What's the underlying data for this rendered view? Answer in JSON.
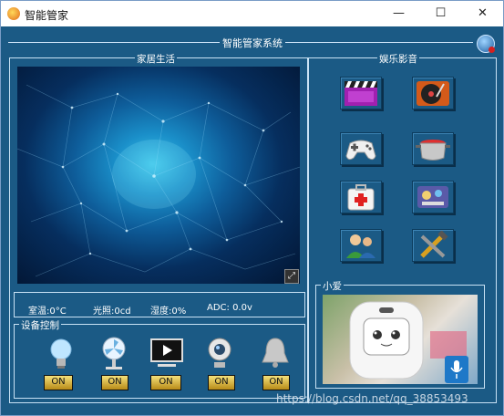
{
  "window": {
    "title": "智能管家",
    "minimize_glyph": "—",
    "maximize_glyph": "☐",
    "close_glyph": "✕"
  },
  "system_title": "智能管家系统",
  "sections": {
    "home": "家居生活",
    "entertainment": "娱乐影音",
    "device_control": "设备控制",
    "xiaoai": "小爱"
  },
  "sensors": {
    "temperature": "室温:0°C",
    "light": "光照:0cd",
    "humidity": "湿度:0%",
    "adc": "ADC: 0.0v"
  },
  "devices": [
    {
      "name": "lamp",
      "icon": "light-bulb-icon",
      "state": "ON"
    },
    {
      "name": "fan",
      "icon": "fan-icon",
      "state": "ON"
    },
    {
      "name": "tv",
      "icon": "play-screen-icon",
      "state": "ON"
    },
    {
      "name": "camera",
      "icon": "webcam-icon",
      "state": "ON"
    },
    {
      "name": "alarm",
      "icon": "bell-icon",
      "state": "ON"
    }
  ],
  "apps": [
    {
      "icon": "video-clapper-icon"
    },
    {
      "icon": "record-player-icon"
    },
    {
      "icon": "gamepad-icon"
    },
    {
      "icon": "cooking-pot-icon"
    },
    {
      "icon": "first-aid-kit-icon"
    },
    {
      "icon": "settings-app-icon"
    },
    {
      "icon": "users-icon"
    },
    {
      "icon": "tools-icon"
    }
  ],
  "watermark": "https://blog.csdn.net/qq_38853493"
}
